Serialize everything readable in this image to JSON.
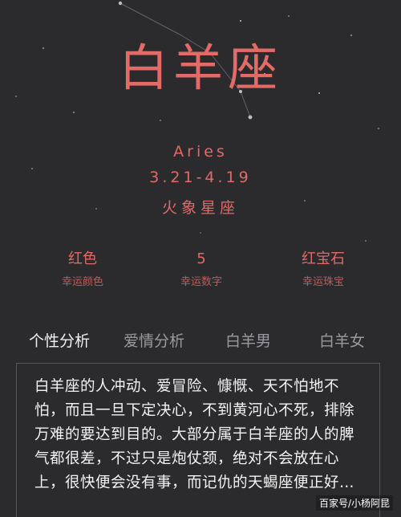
{
  "zodiac": {
    "name_cn": "白羊座",
    "name_en": "Aries",
    "date_range": "3.21-4.19",
    "element": "火象星座"
  },
  "stats": [
    {
      "value": "红色",
      "label": "幸运颜色"
    },
    {
      "value": "5",
      "label": "幸运数字"
    },
    {
      "value": "红宝石",
      "label": "幸运珠宝"
    }
  ],
  "tabs": [
    {
      "label": "个性分析",
      "active": true
    },
    {
      "label": "爱情分析",
      "active": false
    },
    {
      "label": "白羊男",
      "active": false
    },
    {
      "label": "白羊女",
      "active": false
    }
  ],
  "content": {
    "text": "白羊座的人冲动、爱冒险、慷慨、天不怕地不怕，而且一旦下定决心，不到黄河心不死，排除万难的要达到目的。大部分属于白羊座的人的脾气都很差，不过只是炮仗颈，绝对不会放在心上，很快便会没有事，而记仇的天蝎座便正好…"
  },
  "watermark": "百家号/小杨阿昆",
  "colors": {
    "background": "#2b2b2e",
    "accent": "#e06a67",
    "text": "#f3f3f3",
    "tab_inactive": "#9a9a9e"
  }
}
